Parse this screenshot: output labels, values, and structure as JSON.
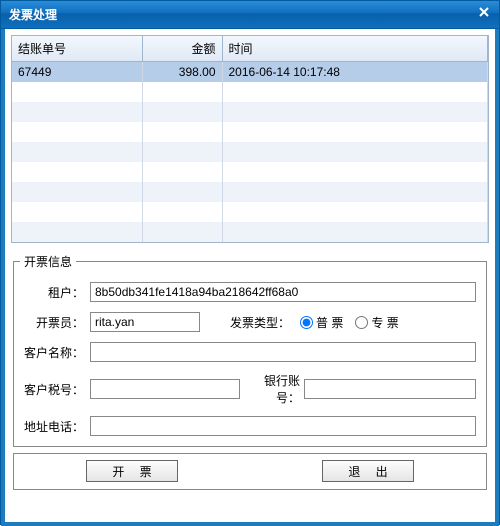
{
  "window": {
    "title": "发票处理"
  },
  "grid": {
    "headers": {
      "bill": "结账单号",
      "amount": "金额",
      "time": "时间"
    },
    "row": {
      "bill": "67449",
      "amount": "398.00",
      "time": "2016-06-14 10:17:48"
    }
  },
  "form": {
    "legend": "开票信息",
    "labels": {
      "tenant": "租户：",
      "clerk": "开票员：",
      "invType": "发票类型：",
      "custName": "客户名称：",
      "custTax": "客户税号：",
      "bank": "银行账号：",
      "addrTel": "地址电话："
    },
    "values": {
      "tenant": "8b50db341fe1418a94ba218642ff68a0",
      "clerk": "rita.yan",
      "custName": "",
      "custTax": "",
      "bank": "",
      "addrTel": ""
    },
    "radios": {
      "normal": "普 票",
      "special": "专 票",
      "selected": "normal"
    }
  },
  "buttons": {
    "issue": "开 票",
    "exit": "退 出"
  }
}
